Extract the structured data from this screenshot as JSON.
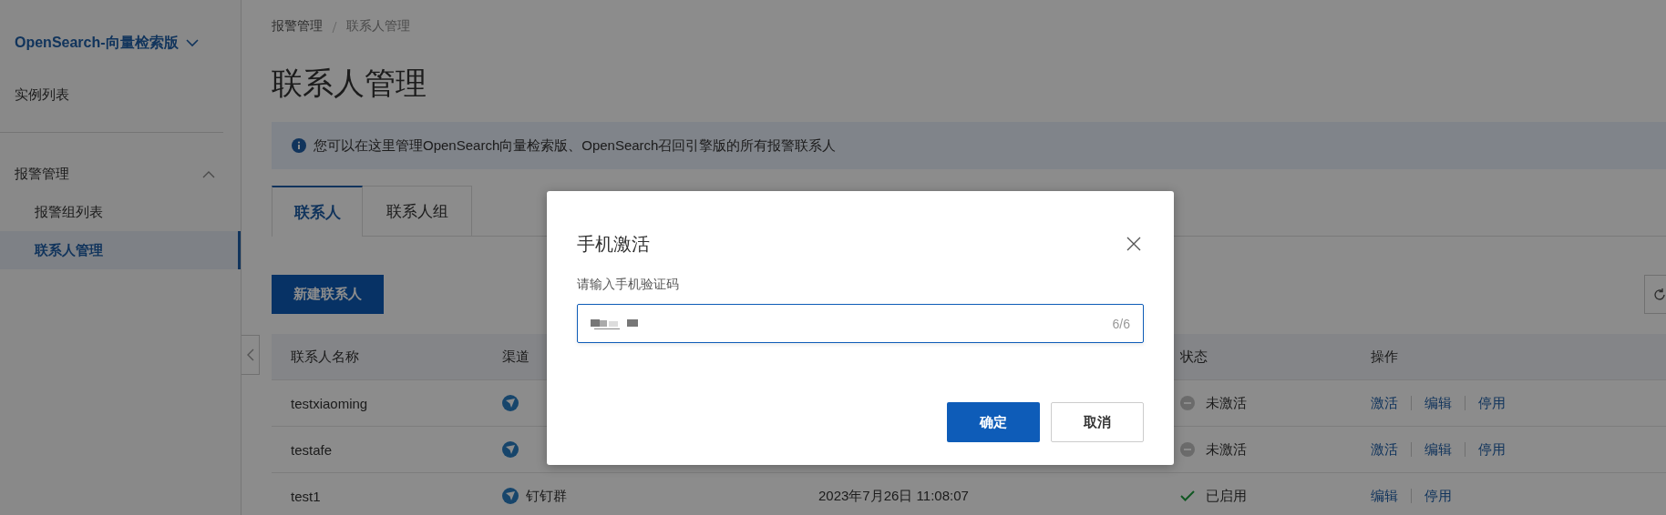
{
  "sidebar": {
    "product": "OpenSearch-向量检索版",
    "items": [
      {
        "label": "实例列表",
        "selected": false
      }
    ],
    "groups": [
      {
        "label": "报警管理",
        "expanded": true,
        "children": [
          {
            "label": "报警组列表",
            "selected": false
          },
          {
            "label": "联系人管理",
            "selected": true
          }
        ]
      }
    ]
  },
  "breadcrumb": [
    "报警管理",
    "联系人管理"
  ],
  "page_title": "联系人管理",
  "notice": "您可以在这里管理OpenSearch向量检索版、OpenSearch召回引擎版的所有报警联系人",
  "tabs": [
    {
      "label": "联系人",
      "selected": true
    },
    {
      "label": "联系人组",
      "selected": false
    }
  ],
  "new_button": "新建联系人",
  "table": {
    "columns": [
      "联系人名称",
      "渠道",
      "状态",
      "操作"
    ],
    "rows": [
      {
        "name": "testxiaoming",
        "status": {
          "kind": "inactive",
          "label": "未激活"
        },
        "actions": [
          "激活",
          "编辑",
          "停用"
        ]
      },
      {
        "name": "testafe",
        "status": {
          "kind": "inactive",
          "label": "未激活"
        },
        "actions": [
          "激活",
          "编辑",
          "停用"
        ]
      },
      {
        "name": "test1",
        "channel": "钉钉群",
        "column_3": "2023年7月26日 11:08:07",
        "status": {
          "kind": "enabled",
          "label": "已启用"
        },
        "actions": [
          "编辑",
          "停用"
        ]
      }
    ]
  },
  "dialog": {
    "title": "手机激活",
    "field_label": "请输入手机验证码",
    "counter": "6/6",
    "buttons": [
      {
        "label": "确定",
        "kind": "primary"
      },
      {
        "label": "取消",
        "kind": "secondary"
      }
    ]
  }
}
